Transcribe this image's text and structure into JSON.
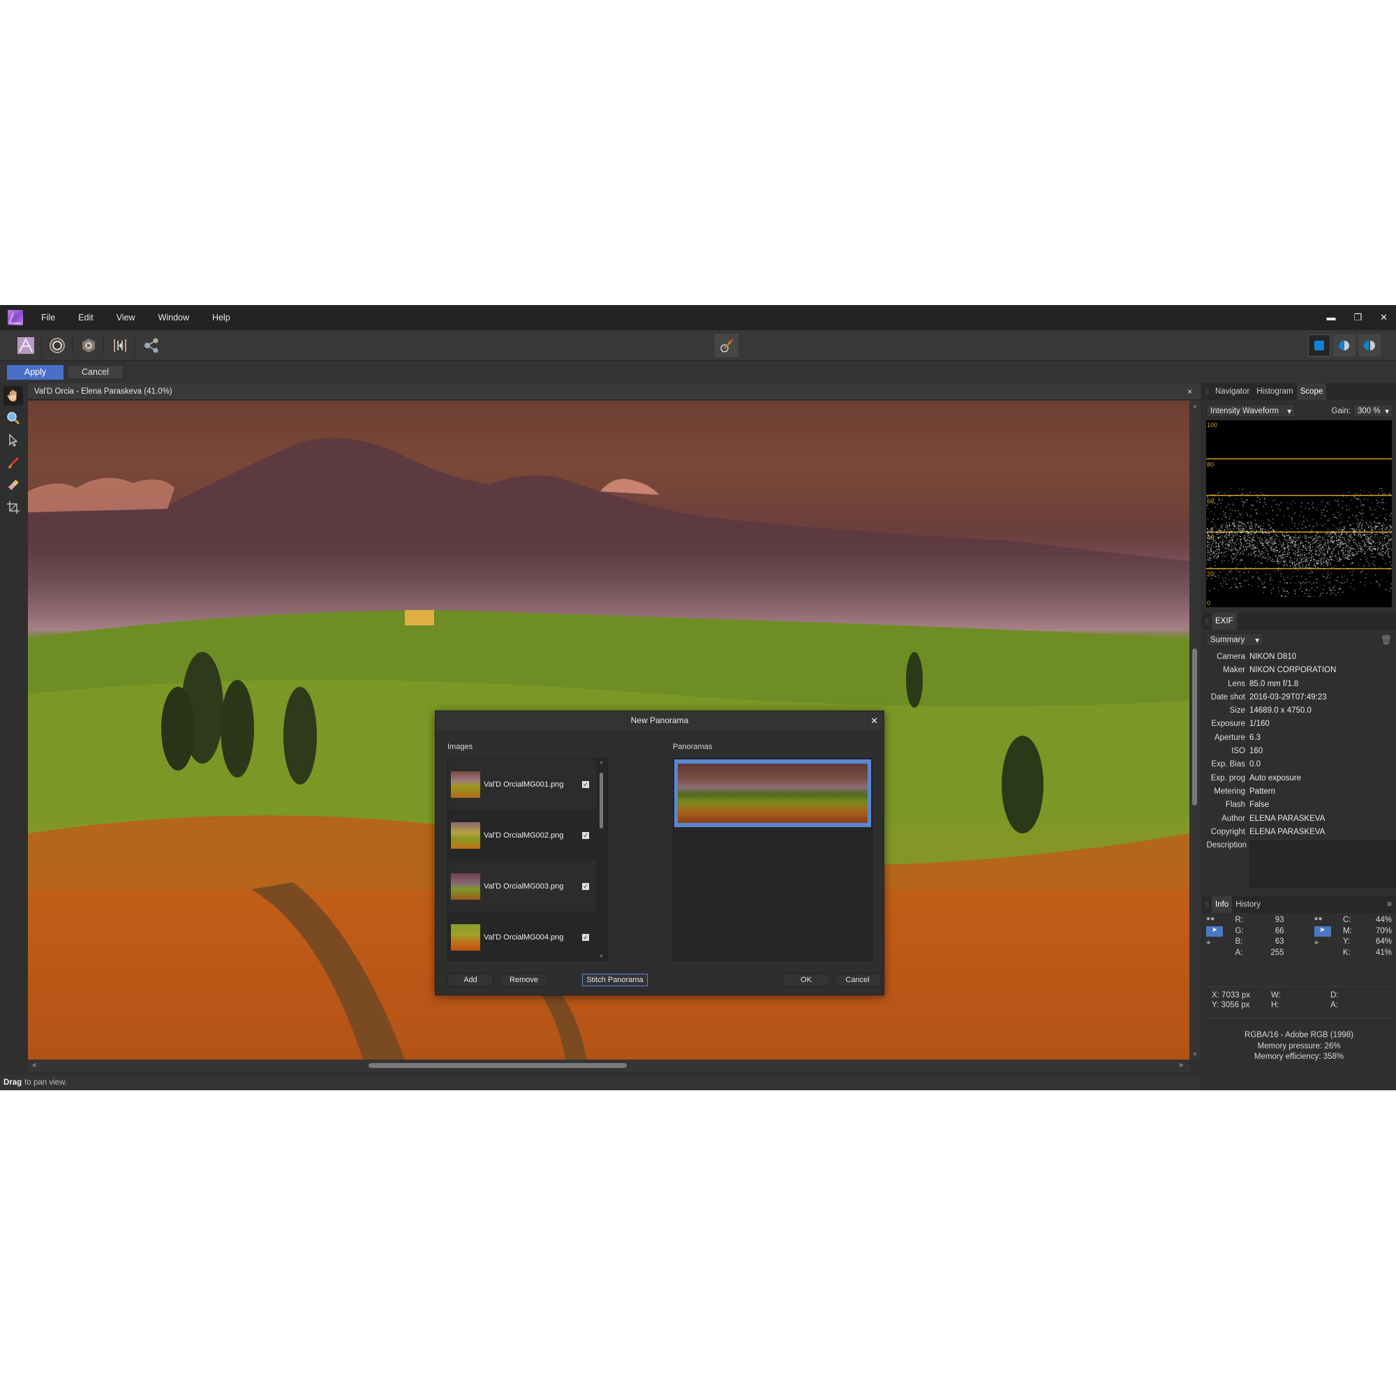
{
  "menubar": {
    "items": [
      "File",
      "Edit",
      "View",
      "Window",
      "Help"
    ],
    "window_controls": [
      "minimize-icon",
      "restore-icon",
      "close-icon"
    ]
  },
  "toolbar": {
    "personas": [
      "photo-persona-icon",
      "liquify-persona-icon",
      "develop-persona-icon",
      "tone-mapping-persona-icon",
      "export-persona-icon"
    ],
    "center_tool": "brush-assistant-icon",
    "view_modes": [
      "single-view-icon",
      "split-view-icon",
      "mirror-view-icon"
    ]
  },
  "context_bar": {
    "apply_label": "Apply",
    "cancel_label": "Cancel",
    "accent": "#4a6fc7"
  },
  "tools": [
    "hand-icon",
    "zoom-icon",
    "move-pointer-icon",
    "paint-brush-icon",
    "eraser-icon",
    "crop-icon"
  ],
  "document": {
    "title": "Val'D Orcia - Elena Paraskeva (41.0%)",
    "close": "×"
  },
  "statusbar": {
    "bold": "Drag",
    "text": "to pan view."
  },
  "right_panel": {
    "top_tabs": [
      "Navigator",
      "Histogram",
      "Scope"
    ],
    "top_active": "Scope",
    "scope": {
      "mode": "Intensity Waveform",
      "gain_label": "Gain:",
      "gain_value": "300 %",
      "scale_labels": [
        "100",
        "80",
        "60",
        "40",
        "20",
        "0"
      ],
      "guide_color": "#d4a017"
    },
    "exif": {
      "tab": "EXIF",
      "view": "Summary",
      "rows": [
        {
          "k": "Camera",
          "v": "NIKON D810"
        },
        {
          "k": "Maker",
          "v": "NIKON CORPORATION"
        },
        {
          "k": "Lens",
          "v": "85.0 mm f/1.8"
        },
        {
          "k": "Date shot",
          "v": "2016-03-29T07:49:23"
        },
        {
          "k": "Size",
          "v": "14689.0 x 4750.0"
        },
        {
          "k": "Exposure",
          "v": "1/160"
        },
        {
          "k": "Aperture",
          "v": "6.3"
        },
        {
          "k": "ISO",
          "v": "160"
        },
        {
          "k": "Exp. Bias",
          "v": "0.0"
        },
        {
          "k": "Exp. prog",
          "v": "Auto exposure"
        },
        {
          "k": "Metering",
          "v": "Pattern"
        },
        {
          "k": "Flash",
          "v": "False"
        },
        {
          "k": "Author",
          "v": "ELENA PARASKEVA"
        },
        {
          "k": "Copyright",
          "v": "ELENA PARASKEVA"
        }
      ],
      "description_label": "Description",
      "description_value": ""
    },
    "info": {
      "tabs": [
        "Info",
        "History"
      ],
      "active": "Info",
      "rgb": [
        {
          "k": "R:",
          "v": "93"
        },
        {
          "k": "G:",
          "v": "66"
        },
        {
          "k": "B:",
          "v": "63"
        },
        {
          "k": "A:",
          "v": "255"
        }
      ],
      "cmyk": [
        {
          "k": "C:",
          "v": "44%"
        },
        {
          "k": "M:",
          "v": "70%"
        },
        {
          "k": "Y:",
          "v": "64%"
        },
        {
          "k": "K:",
          "v": "41%"
        }
      ],
      "x": "X: 7033 px",
      "y": "Y: 3056 px",
      "w": "W:",
      "h": "H:",
      "d": "D:",
      "a": "A:",
      "color_format": "RGBA/16 - Adobe RGB (1998)",
      "memory_pressure": "Memory pressure: 26%",
      "memory_efficiency": "Memory efficiency: 358%"
    }
  },
  "dialog": {
    "title": "New Panorama",
    "images_label": "Images",
    "panoramas_label": "Panoramas",
    "images": [
      {
        "name": "Val'D OrcialMG001.png",
        "checked": true
      },
      {
        "name": "Val'D OrcialMG002.png",
        "checked": true
      },
      {
        "name": "Val'D OrcialMG003.png",
        "checked": true
      },
      {
        "name": "Val'D OrcialMG004.png",
        "checked": true
      }
    ],
    "check_glyph": "✓",
    "buttons": {
      "add": "Add",
      "remove": "Remove",
      "stitch": "Stitch Panorama",
      "ok": "OK",
      "cancel": "Cancel"
    },
    "selection_color": "#5b86d4"
  }
}
